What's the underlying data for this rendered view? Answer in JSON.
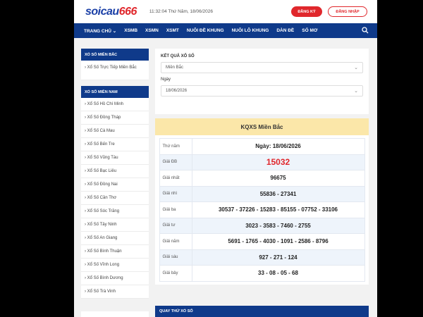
{
  "header": {
    "logo_main": "soicau",
    "logo_accent": "666",
    "datetime": "11:32:04 Thứ Năm, 18/06/2026",
    "register_label": "ĐĂNG KÝ",
    "login_label": "ĐĂNG NHẬP"
  },
  "nav": {
    "items": [
      "TRANG CHỦ ⌄",
      "XSMB",
      "XSMN",
      "XSMT",
      "NUÔI ĐỀ KHUNG",
      "NUÔI LÔ KHUNG",
      "DÀN ĐỀ",
      "SỐ MƠ"
    ],
    "search_icon": "search-icon"
  },
  "sidebar": {
    "mien_bac": {
      "title": "XỔ SỐ MIỀN BẮC",
      "items": [
        "› Xổ Số Trực Tiếp Miền Bắc"
      ]
    },
    "mien_nam": {
      "title": "XỔ SỐ MIỀN NAM",
      "items": [
        "› Xổ Số Hồ Chí Minh",
        "› Xổ Số Đồng Tháp",
        "› Xổ Số Cà Mau",
        "› Xổ Số Bến Tre",
        "› Xổ Số Vũng Tàu",
        "› Xổ Số Bạc Liêu",
        "› Xổ Số Đồng Nai",
        "› Xổ Số Cần Thơ",
        "› Xổ Số Sóc Trăng",
        "› Xổ Số Tây Ninh",
        "› Xổ Số An Giang",
        "› Xổ Số Bình Thuận",
        "› Xổ Số Vĩnh Long",
        "› Xổ Số Bình Dương",
        "› Xổ Số Trà Vinh"
      ]
    }
  },
  "form": {
    "title": "KẾT QUẢ XỔ SỐ",
    "region_value": "Miền Bắc",
    "date_label": "Ngày",
    "date_value": "18/06/2026"
  },
  "result": {
    "heading": "KQXS Miền Bắc",
    "rows": [
      {
        "label": "Thứ năm",
        "value": "Ngày: 18/06/2026"
      },
      {
        "label": "Giải ĐB",
        "value": "15032"
      },
      {
        "label": "Giải nhất",
        "value": "96675"
      },
      {
        "label": "Giải nhì",
        "value": "55836 - 27341"
      },
      {
        "label": "Giải ba",
        "value": "30537 - 37226 - 15283 - 85155 - 07752 - 33106"
      },
      {
        "label": "Giải tư",
        "value": "3023 - 3583 - 7460 - 2755"
      },
      {
        "label": "Giải năm",
        "value": "5691 - 1765 - 4030 - 1091 - 2586 - 8796"
      },
      {
        "label": "Giải sáu",
        "value": "927 - 271 - 124"
      },
      {
        "label": "Giải bảy",
        "value": "33 - 08 - 05 - 68"
      }
    ]
  },
  "bottom": {
    "title": "QUAY THỬ XỔ SỐ"
  },
  "colors": {
    "brand_blue": "#0f3a8a",
    "brand_red": "#e0272c",
    "result_header": "#fbe7a9"
  }
}
